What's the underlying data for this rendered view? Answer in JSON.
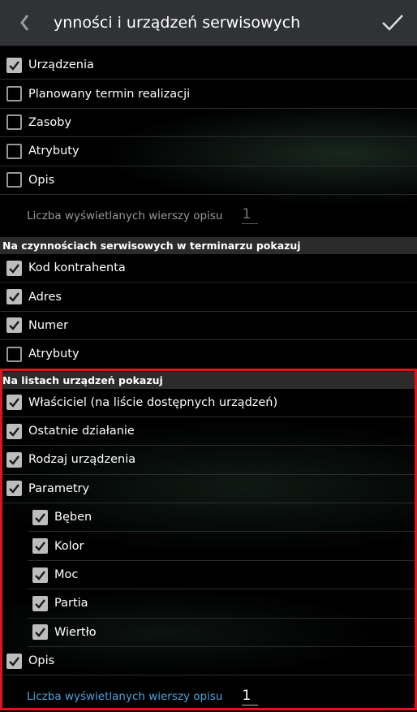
{
  "header": {
    "title": "ynności i urządzeń serwisowych",
    "back_icon": "chevron-left-icon",
    "confirm_icon": "check-icon"
  },
  "section1": {
    "items": [
      {
        "label": "Urządzenia",
        "checked": true
      },
      {
        "label": "Planowany termin realizacji",
        "checked": false
      },
      {
        "label": "Zasoby",
        "checked": false
      },
      {
        "label": "Atrybuty",
        "checked": false
      },
      {
        "label": "Opis",
        "checked": false
      }
    ],
    "lines_label": "Liczba wyświetlanych wierszy opisu",
    "lines_value": "1"
  },
  "section2": {
    "header": "Na czynnościach serwisowych w terminarzu pokazuj",
    "items": [
      {
        "label": "Kod kontrahenta",
        "checked": true
      },
      {
        "label": "Adres",
        "checked": true
      },
      {
        "label": "Numer",
        "checked": true
      },
      {
        "label": "Atrybuty",
        "checked": false
      }
    ]
  },
  "section3": {
    "header": "Na listach urządzeń pokazuj",
    "items": [
      {
        "label": "Właściciel (na liście dostępnych urządzeń)",
        "checked": true
      },
      {
        "label": "Ostatnie działanie",
        "checked": true
      },
      {
        "label": "Rodzaj urządzenia",
        "checked": true
      },
      {
        "label": "Parametry",
        "checked": true
      }
    ],
    "params": [
      {
        "label": "Bęben",
        "checked": true
      },
      {
        "label": "Kolor",
        "checked": true
      },
      {
        "label": "Moc",
        "checked": true
      },
      {
        "label": "Partia",
        "checked": true
      },
      {
        "label": "Wiertło",
        "checked": true
      }
    ],
    "opis": {
      "label": "Opis",
      "checked": true
    },
    "lines_label": "Liczba wyświetlanych wierszy opisu",
    "lines_value": "1"
  },
  "colors": {
    "actionbar": "#303236",
    "section_header": "#2b2b2b",
    "highlight": "#e0141b",
    "link_blue": "#4aa3df"
  }
}
